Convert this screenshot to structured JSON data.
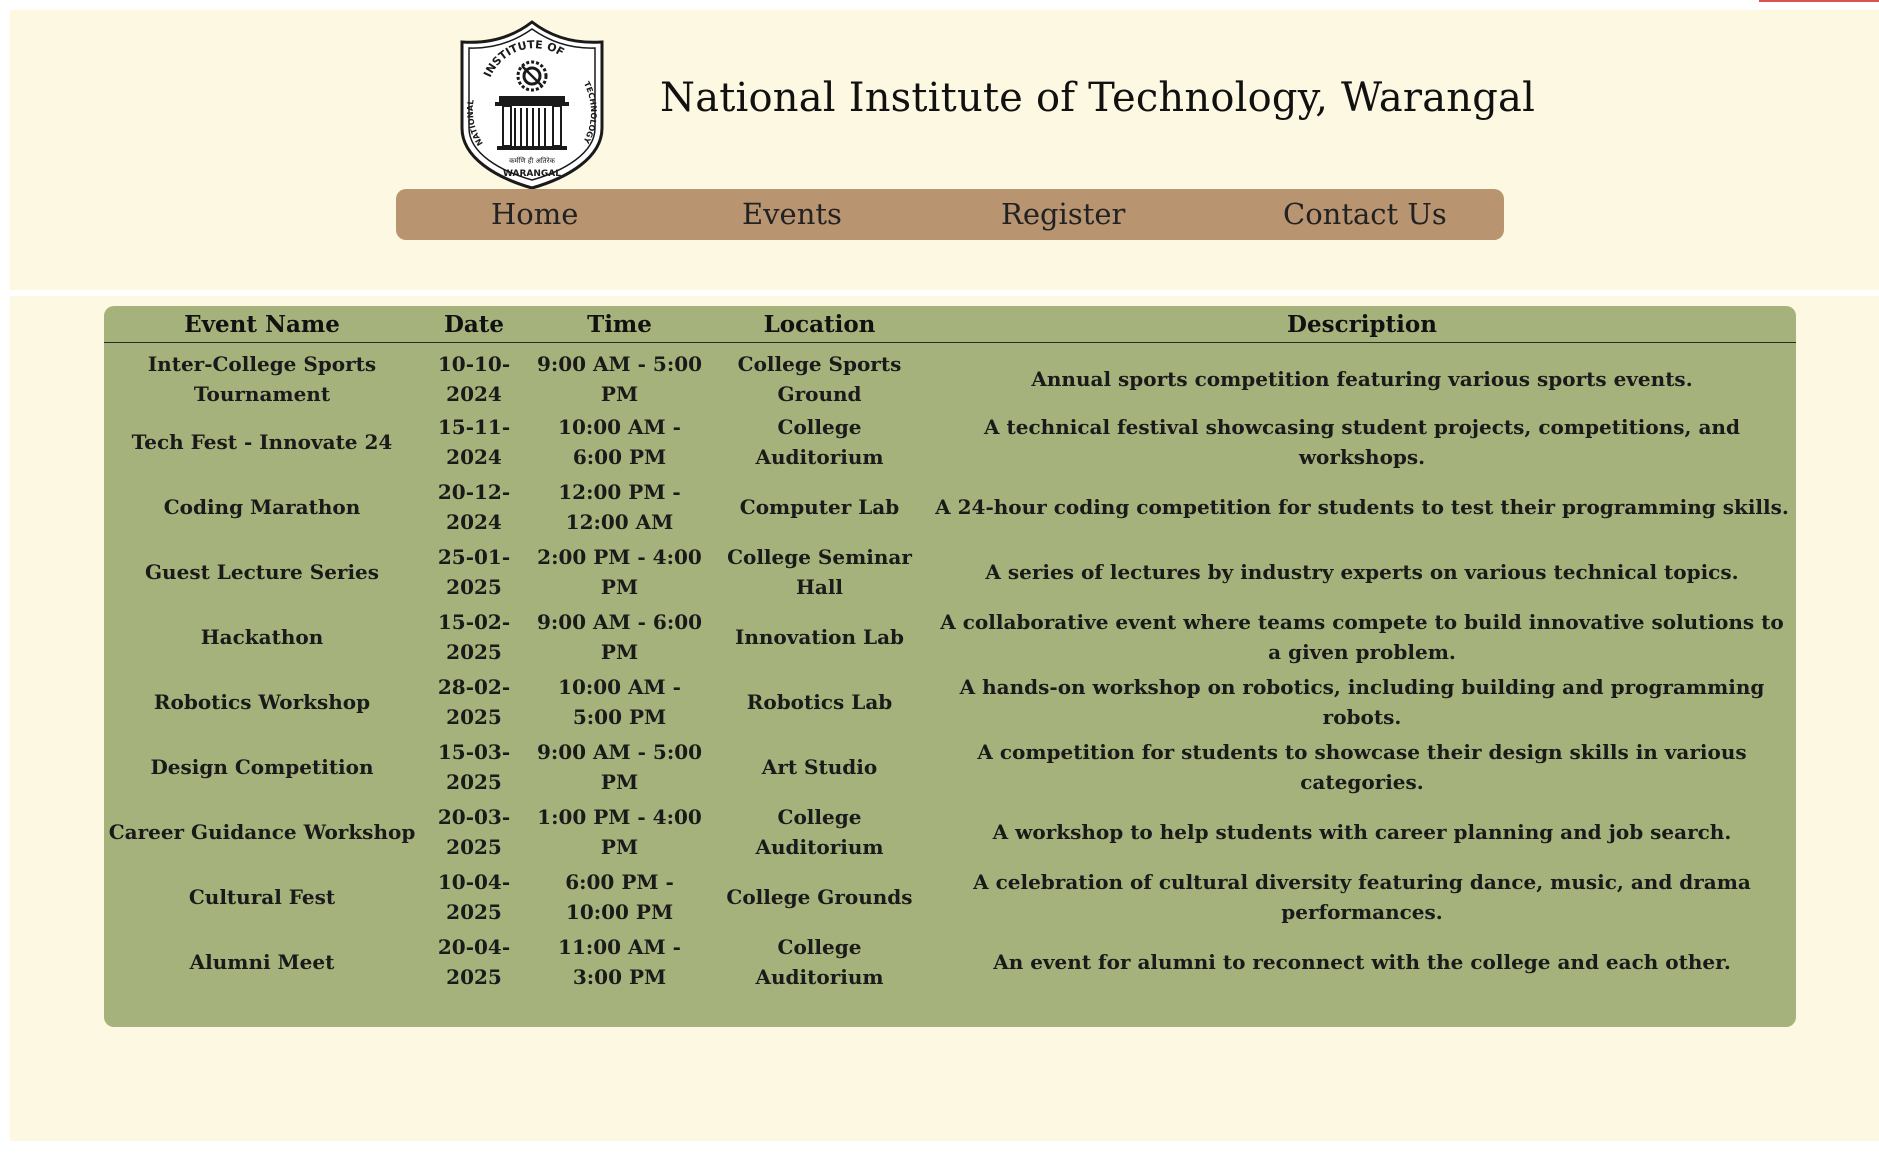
{
  "header": {
    "title": "National Institute of Technology, Warangal",
    "logo": {
      "icon": "institute-emblem",
      "text_top": "INSTITUTE OF",
      "text_left": "NATIONAL",
      "text_right": "TECHNOLOGY",
      "text_bottom": "WARANGAL",
      "motto": "कर्मणि ही अतिरेक"
    }
  },
  "nav": {
    "items": [
      {
        "label": "Home"
      },
      {
        "label": "Events"
      },
      {
        "label": "Register"
      },
      {
        "label": "Contact Us"
      }
    ]
  },
  "events_table": {
    "columns": [
      "Event Name",
      "Date",
      "Time",
      "Location",
      "Description"
    ],
    "rows": [
      [
        "Inter-College Sports Tournament",
        "10-10-2024",
        "9:00 AM - 5:00 PM",
        "College Sports Ground",
        "Annual sports competition featuring various sports events."
      ],
      [
        "Tech Fest - Innovate 24",
        "15-11-2024",
        "10:00 AM - 6:00 PM",
        "College Auditorium",
        "A technical festival showcasing student projects, competitions, and workshops."
      ],
      [
        "Coding Marathon",
        "20-12-2024",
        "12:00 PM - 12:00 AM",
        "Computer Lab",
        "A 24-hour coding competition for students to test their programming skills."
      ],
      [
        "Guest Lecture Series",
        "25-01-2025",
        "2:00 PM - 4:00 PM",
        "College Seminar Hall",
        "A series of lectures by industry experts on various technical topics."
      ],
      [
        "Hackathon",
        "15-02-2025",
        "9:00 AM - 6:00 PM",
        "Innovation Lab",
        "A collaborative event where teams compete to build innovative solutions to a given problem."
      ],
      [
        "Robotics Workshop",
        "28-02-2025",
        "10:00 AM - 5:00 PM",
        "Robotics Lab",
        "A hands-on workshop on robotics, including building and programming robots."
      ],
      [
        "Design Competition",
        "15-03-2025",
        "9:00 AM - 5:00 PM",
        "Art Studio",
        "A competition for students to showcase their design skills in various categories."
      ],
      [
        "Career Guidance Workshop",
        "20-03-2025",
        "1:00 PM - 4:00 PM",
        "College Auditorium",
        "A workshop to help students with career planning and job search."
      ],
      [
        "Cultural Fest",
        "10-04-2025",
        "6:00 PM - 10:00 PM",
        "College Grounds",
        "A celebration of cultural diversity featuring dance, music, and drama performances."
      ],
      [
        "Alumni Meet",
        "20-04-2025",
        "11:00 AM - 3:00 PM",
        "College Auditorium",
        "An event for alumni to reconnect with the college and each other."
      ]
    ]
  },
  "colors": {
    "page_bg": "#fdf8e1",
    "nav_bg": "#b89471",
    "table_bg": "#a6b27b",
    "text": "#111111"
  }
}
